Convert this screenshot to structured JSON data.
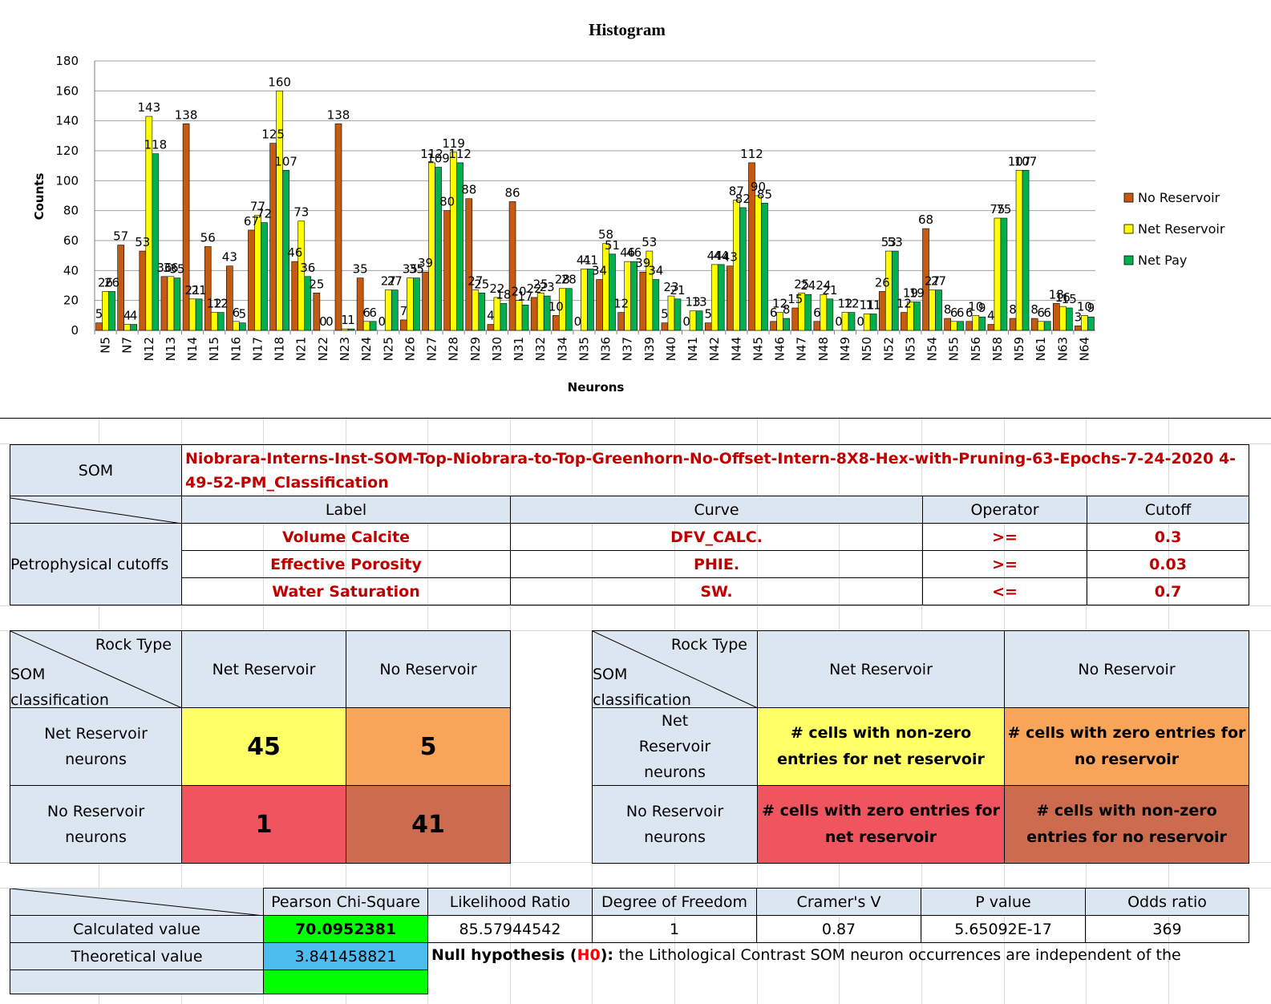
{
  "chart_data": {
    "type": "bar",
    "title": "Histogram",
    "xlabel": "Neurons",
    "ylabel": "Counts",
    "ylim": [
      0,
      180
    ],
    "yticks": [
      0,
      20,
      40,
      60,
      80,
      100,
      120,
      140,
      160,
      180
    ],
    "legend_position": "right",
    "categories": [
      "N5",
      "N7",
      "N12",
      "N13",
      "N14",
      "N15",
      "N16",
      "N17",
      "N18",
      "N21",
      "N22",
      "N23",
      "N24",
      "N25",
      "N26",
      "N27",
      "N28",
      "N29",
      "N30",
      "N31",
      "N32",
      "N34",
      "N35",
      "N36",
      "N37",
      "N39",
      "N40",
      "N41",
      "N42",
      "N44",
      "N45",
      "N46",
      "N47",
      "N48",
      "N49",
      "N50",
      "N52",
      "N53",
      "N54",
      "N55",
      "N56",
      "N58",
      "N59",
      "N61",
      "N63",
      "N64"
    ],
    "series": [
      {
        "name": "No Reservoir",
        "color": "#c55a11",
        "values": [
          5,
          57,
          53,
          36,
          138,
          56,
          43,
          67,
          125,
          46,
          25,
          138,
          35,
          0,
          7,
          39,
          80,
          88,
          4,
          86,
          22,
          10,
          0,
          34,
          12,
          39,
          5,
          0,
          5,
          43,
          112,
          6,
          15,
          6,
          0,
          0,
          26,
          12,
          68,
          8,
          6,
          4,
          8,
          8,
          18,
          3
        ]
      },
      {
        "name": "Net Reservoir",
        "color": "#ffff00",
        "values": [
          26,
          4,
          143,
          36,
          21,
          12,
          6,
          77,
          160,
          73,
          0,
          1,
          6,
          27,
          35,
          112,
          119,
          27,
          22,
          20,
          25,
          28,
          41,
          58,
          46,
          53,
          23,
          13,
          44,
          87,
          90,
          12,
          25,
          24,
          12,
          11,
          53,
          19,
          27,
          6,
          10,
          75,
          107,
          6,
          16,
          10
        ]
      },
      {
        "name": "Net Pay",
        "color": "#00b050",
        "values": [
          26,
          4,
          118,
          35,
          21,
          12,
          5,
          72,
          107,
          36,
          0,
          1,
          6,
          27,
          35,
          109,
          112,
          25,
          18,
          17,
          23,
          28,
          41,
          51,
          46,
          34,
          21,
          13,
          44,
          82,
          85,
          8,
          24,
          21,
          12,
          11,
          53,
          19,
          27,
          6,
          9,
          75,
          107,
          6,
          15,
          9
        ]
      }
    ]
  },
  "som": {
    "label": "SOM",
    "name": "Niobrara-Interns-Inst-SOM-Top-Niobrara-to-Top-Greenhorn-No-Offset-Intern-8X8-Hex-with-Pruning-63-Epochs-7-24-2020 4-49-52-PM_Classification"
  },
  "cutoffs": {
    "section_label": "Petrophysical cutoffs",
    "headers": [
      "Label",
      "Curve",
      "Operator",
      "Cutoff"
    ],
    "rows": [
      {
        "label": "Volume Calcite",
        "curve": "DFV_CALC.",
        "operator": ">=",
        "cutoff": "0.3"
      },
      {
        "label": "Effective Porosity",
        "curve": "PHIE.",
        "operator": ">=",
        "cutoff": "0.03"
      },
      {
        "label": "Water Saturation",
        "curve": "SW.",
        "operator": "<=",
        "cutoff": "0.7"
      }
    ]
  },
  "contingency": {
    "corner_top": "Rock Type",
    "corner_bottom": "SOM classification",
    "col_net": "Net Reservoir",
    "col_no": "No Reservoir",
    "row_net": "Net Reservoir neurons",
    "row_no": "No Reservoir neurons",
    "a": "45",
    "b": "5",
    "c": "1",
    "d": "41"
  },
  "legend_table": {
    "corner_top": "Rock Type",
    "corner_bottom": "SOM classification",
    "col_net": "Net Reservoir",
    "col_no": "No Reservoir",
    "row_net": "Net Reservoir neurons",
    "row_no": "No Reservoir neurons",
    "a": "# cells with non-zero entries for net reservoir",
    "b": "# cells with zero entries for no reservoir",
    "c": "# cells with zero entries for net reservoir",
    "d": "# cells with non-zero entries for no reservoir"
  },
  "stats": {
    "headers": [
      "Pearson Chi-Square",
      "Likelihood Ratio",
      "Degree of Freedom",
      "Cramer's V",
      "P value",
      "Odds ratio"
    ],
    "calc_label": "Calculated value",
    "calc_values": [
      "70.0952381",
      "85.57944542",
      "1",
      "0.87",
      "5.65092E-17",
      "369"
    ],
    "theo_label": "Theoretical value",
    "theo_value": "3.841458821",
    "null_prefix": "Null hypothesis (",
    "null_h0": "H0",
    "null_suffix": "): ",
    "null_text": "the Lithological Contrast SOM neuron occurrences are independent of the"
  },
  "colors": {
    "header_blue": "#dce6f1",
    "yellow": "#ffff66",
    "orange": "#f8a55a",
    "red": "#f0545e",
    "brown": "#cc6b4e",
    "green": "#00ff00",
    "cyan": "#4dbdf0",
    "title_red": "#c00000"
  }
}
